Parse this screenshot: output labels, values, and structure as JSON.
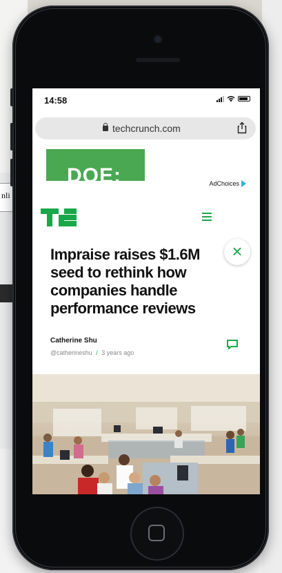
{
  "status_bar": {
    "time": "14:58"
  },
  "browser": {
    "url": "techcrunch.com"
  },
  "ad": {
    "banner_text": "DOE:",
    "adchoices_label": "AdChoices"
  },
  "background": {
    "left_strip_text": "nli"
  },
  "article": {
    "headline": "Impraise raises $1.6M seed to rethink how companies handle performance reviews",
    "author": "Catherine Shu",
    "author_handle": "@catherineshu",
    "separator": "/",
    "timestamp": "3 years ago"
  },
  "colors": {
    "tc_green": "#19a74a",
    "ad_green": "#4aa852"
  },
  "icons": [
    "lock-icon",
    "share-icon",
    "tc-logo",
    "menu-icon",
    "close-icon",
    "comment-icon",
    "adchoices-icon"
  ]
}
